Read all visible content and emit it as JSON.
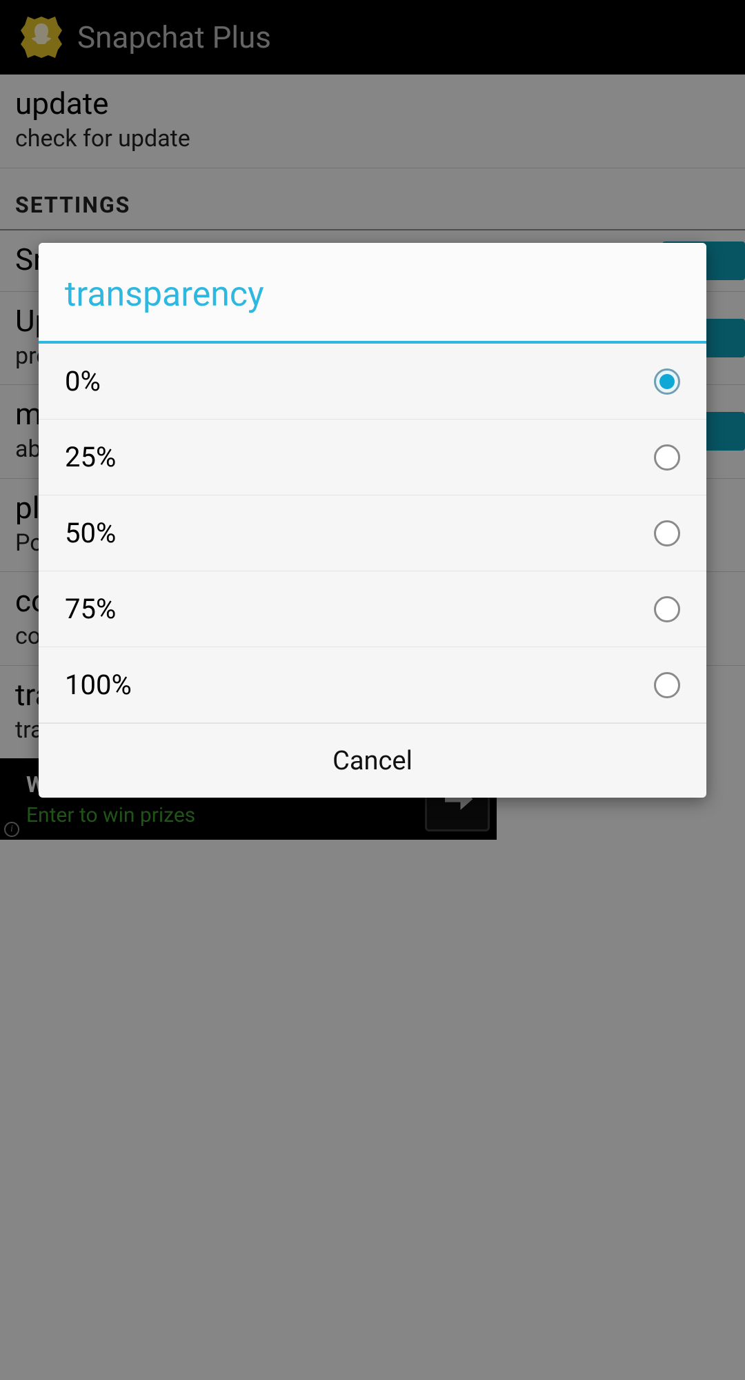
{
  "header": {
    "title": "Snapchat Plus"
  },
  "page": {
    "update": {
      "title": "update",
      "sub": "check for update"
    },
    "settings_header": "SETTINGS",
    "rows": [
      {
        "title": "Snapchat",
        "sub": ""
      },
      {
        "title": "Upload",
        "sub": "press to\nto"
      },
      {
        "title": "more",
        "sub": "about"
      },
      {
        "title": "place",
        "sub": "Position"
      },
      {
        "title": "color",
        "sub": "color"
      },
      {
        "title": "transparency",
        "sub": "transparency of button"
      }
    ]
  },
  "ad": {
    "title": "Win prizes",
    "sub": "Enter to win prizes"
  },
  "dialog": {
    "title": "transparency",
    "options": [
      "0%",
      "25%",
      "50%",
      "75%",
      "100%"
    ],
    "selected_index": 0,
    "cancel": "Cancel"
  }
}
